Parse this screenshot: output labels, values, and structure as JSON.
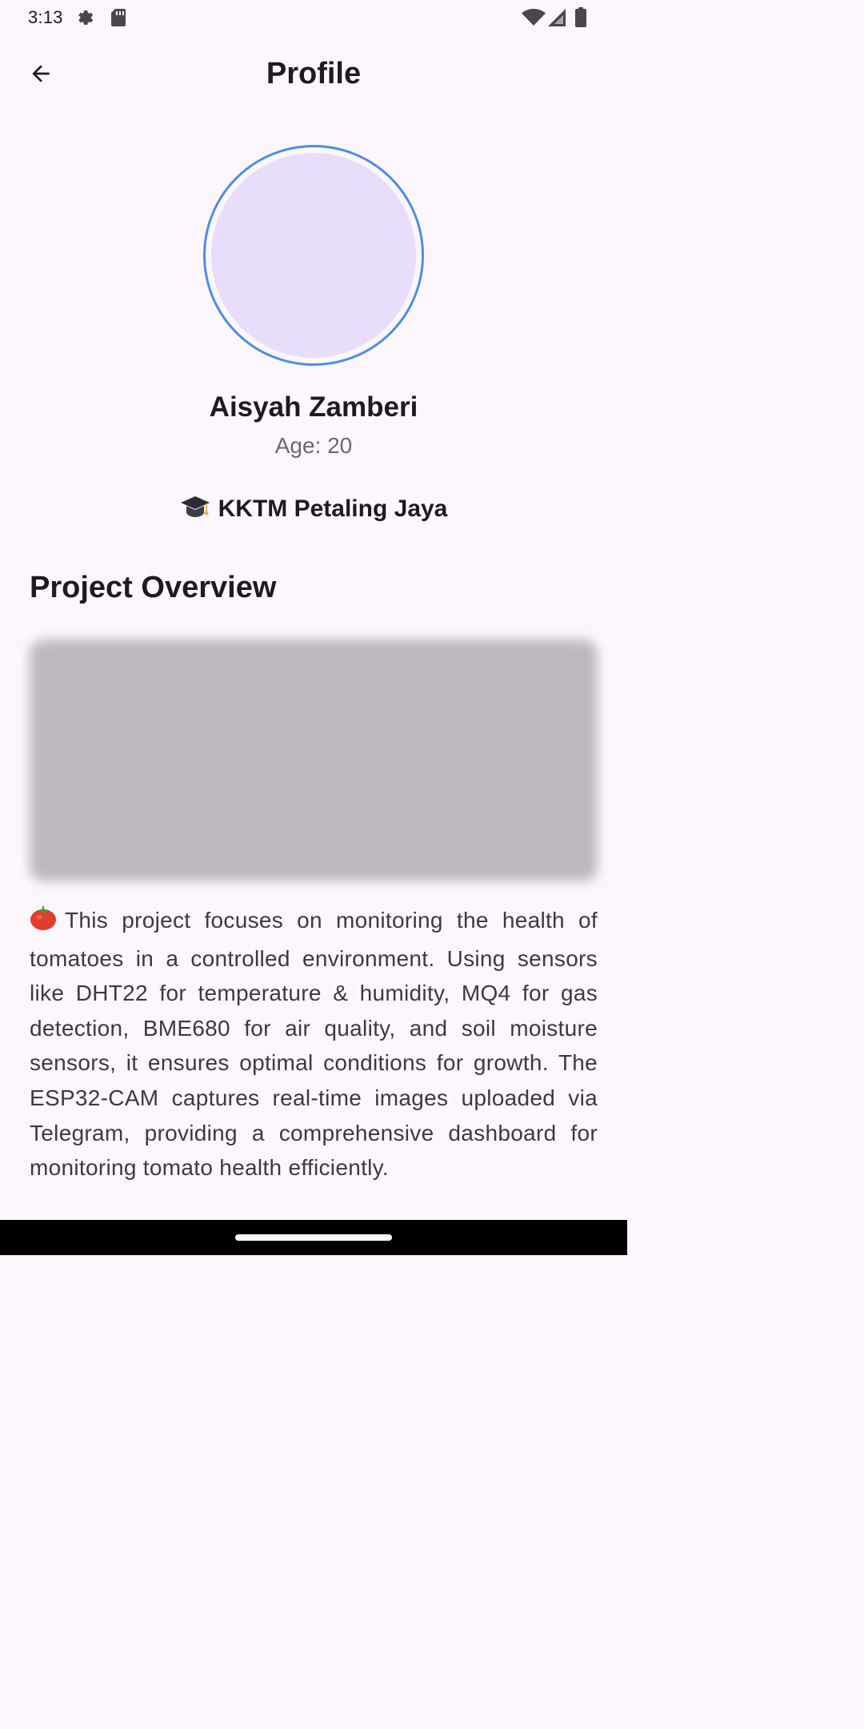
{
  "status_bar": {
    "time": "3:13",
    "icons": [
      "settings-icon",
      "sd-card-icon",
      "wifi-icon",
      "cellular-signal-icon",
      "battery-icon"
    ]
  },
  "app_bar": {
    "back_icon": "arrow-back-icon",
    "title": "Profile"
  },
  "profile": {
    "name": "Aisyah Zamberi",
    "age": "Age: 20",
    "institution_icon": "graduation-cap-icon",
    "institution": "KKTM Petaling Jaya"
  },
  "project": {
    "section_title": "Project Overview",
    "description_icon": "tomato-icon",
    "description": "This project focuses on monitoring the health of tomatoes in a controlled environment. Using sensors like DHT22 for temperature & humidity, MQ4 for gas detection, BME680 for air quality, and soil moisture sensors, it ensures optimal conditions for growth. The ESP32-CAM captures real-time images uploaded via Telegram, providing a comprehensive dashboard for monitoring tomato health efficiently."
  },
  "colors": {
    "background": "#fdf7fd",
    "avatar_ring": "#4a8ee8",
    "avatar_fill": "#e8defc",
    "text_primary": "#1d1b20",
    "text_secondary": "#6c6770"
  }
}
